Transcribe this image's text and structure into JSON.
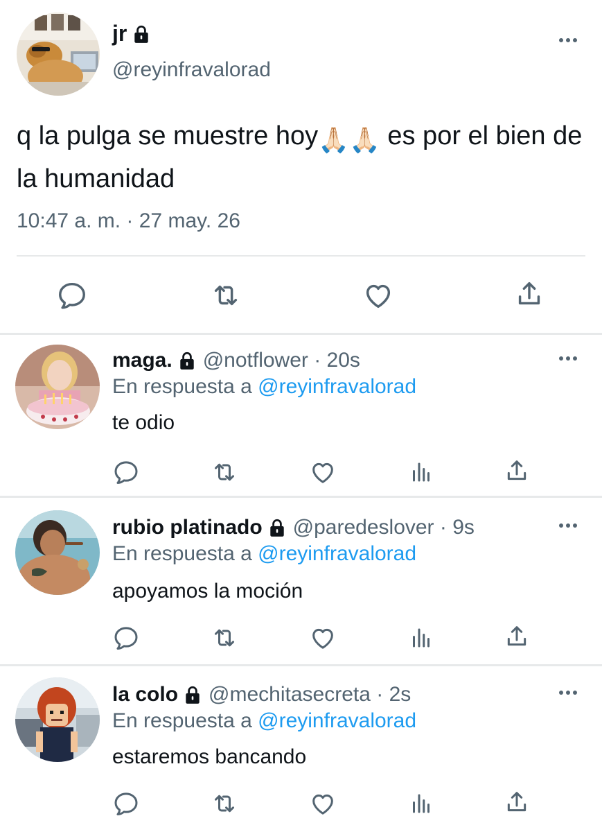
{
  "main_tweet": {
    "name": "jr",
    "handle": "@reyinfravalorad",
    "text_part1": "q la pulga se muestre hoy",
    "text_emojis": "🙏🏻🙏🏻",
    "text_part2": " es por el bien de la humanidad",
    "timestamp": "10:47 a. m. · 27 may. 26"
  },
  "replies": [
    {
      "name": "maga.",
      "handle": "@notflower · 20s",
      "reply_prefix": "En respuesta a ",
      "reply_to": "@reyinfravalorad",
      "text": "te odio"
    },
    {
      "name": "rubio platinado",
      "handle": "@paredeslover · 9s",
      "reply_prefix": "En respuesta a ",
      "reply_to": "@reyinfravalorad",
      "text": "apoyamos la moción"
    },
    {
      "name": "la colo",
      "handle": "@mechitasecreta · 2s",
      "reply_prefix": "En respuesta a ",
      "reply_to": "@reyinfravalorad",
      "text": "estaremos bancando"
    }
  ],
  "icons": {
    "reply": "reply-icon",
    "retweet": "retweet-icon",
    "like": "like-icon",
    "views": "views-icon",
    "share": "share-icon",
    "more": "more-icon",
    "lock": "lock-icon"
  },
  "colors": {
    "text": "#0f1419",
    "secondary": "#536471",
    "link": "#1d9bf0",
    "divider": "#e7e9ea"
  }
}
